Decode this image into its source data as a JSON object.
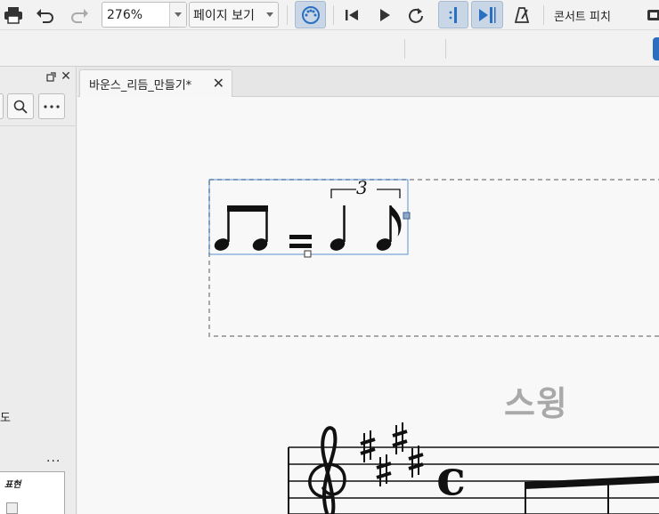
{
  "toolbar": {
    "zoom_value": "276%",
    "view_mode": "페이지 보기",
    "concert_pitch_label": "콘서트 피치"
  },
  "palette": {
    "items": [
      {
        "name": "64th-note"
      },
      {
        "name": "32nd-note"
      },
      {
        "name": "16th-note"
      },
      {
        "name": "8th-note"
      },
      {
        "name": "quarter-note"
      },
      {
        "name": "half-note"
      },
      {
        "name": "whole-note"
      },
      {
        "name": "double-whole-note"
      },
      {
        "name": "augmentation-dot"
      },
      {
        "name": "double-dot"
      },
      {
        "name": "triple-dot"
      },
      {
        "name": "quadruple-dot"
      },
      {
        "name": "tie"
      },
      {
        "name": "flip-direction"
      },
      {
        "name": "double-sharp"
      },
      {
        "name": "sharp"
      },
      {
        "name": "natural"
      },
      {
        "name": "flat"
      },
      {
        "name": "double-flat"
      },
      {
        "name": "voice"
      }
    ],
    "labels": {
      "dot": ".",
      "double_dot": "..",
      "triple_dot": "...",
      "quad_dot": "....",
      "double_sharp": "𝄪",
      "sharp": "♯",
      "natural": "♮",
      "flat": "♭",
      "double_flat": "𝄫"
    }
  },
  "left_panel": {
    "partial_label": "도",
    "more_label": "...",
    "box_title": "표현"
  },
  "tab": {
    "title": "바운스_리듬_만들기*",
    "close": "✕"
  },
  "score": {
    "swing_text": "스윙",
    "tuplet_number": "3",
    "equals_sign": "=",
    "key_signature": "E major (4 sharps)",
    "time_signature": "c"
  },
  "colors": {
    "selection": "#5b8fd1",
    "accent": "#3a79c6",
    "swing_text": "#a9a9a9"
  }
}
